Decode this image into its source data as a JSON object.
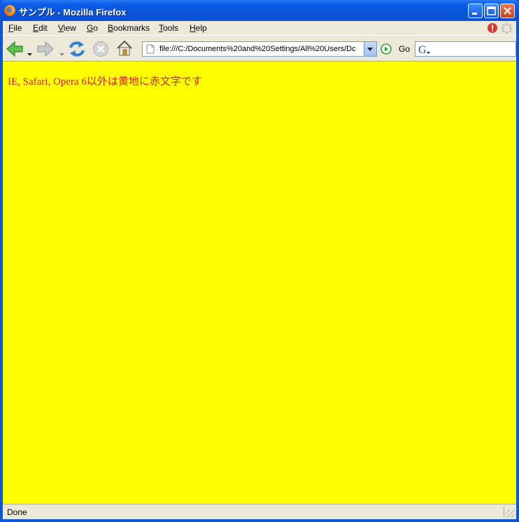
{
  "window": {
    "title": "サンプル - Mozilla Firefox"
  },
  "menu": {
    "items": [
      {
        "label": "File",
        "accel": "F",
        "rest": "ile"
      },
      {
        "label": "Edit",
        "accel": "E",
        "rest": "dit"
      },
      {
        "label": "View",
        "accel": "V",
        "rest": "iew"
      },
      {
        "label": "Go",
        "accel": "G",
        "rest": "o"
      },
      {
        "label": "Bookmarks",
        "accel": "B",
        "rest": "ookmarks"
      },
      {
        "label": "Tools",
        "accel": "T",
        "rest": "ools"
      },
      {
        "label": "Help",
        "accel": "H",
        "rest": "elp"
      }
    ]
  },
  "toolbar": {
    "url": "file:///C:/Documents%20and%20Settings/All%20Users/Dc",
    "go_label": "Go",
    "search_value": ""
  },
  "page": {
    "text": "IE, Safari, Opera 6以外は黄地に赤文字です",
    "background": "#ffff00",
    "text_color": "#e02020"
  },
  "status": {
    "text": "Done"
  }
}
